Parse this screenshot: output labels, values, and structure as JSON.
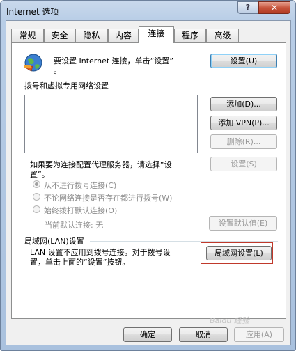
{
  "window": {
    "title": "Internet 选项",
    "help_label": "?",
    "close_label": "✕"
  },
  "tabs": [
    {
      "label": "常规"
    },
    {
      "label": "安全"
    },
    {
      "label": "隐私"
    },
    {
      "label": "内容"
    },
    {
      "label": "连接",
      "active": true
    },
    {
      "label": "程序"
    },
    {
      "label": "高级"
    }
  ],
  "setup": {
    "text_line1": "要设置 Internet 连接，单击“设置”",
    "text_line2": "。",
    "button": "设置(U)",
    "icon": "globe-network-icon"
  },
  "dialup": {
    "heading": "拨号和虚拟专用网络设置",
    "add_button": "添加(D)...",
    "add_vpn_button": "添加 VPN(P)...",
    "delete_button": "删除(R)...",
    "proxy_hint_line1": "如果要为连接配置代理服务器，请选择“设",
    "proxy_hint_line2": "置”。",
    "settings_button": "设置(S)",
    "options": [
      {
        "label": "从不进行拨号连接(C)",
        "checked": true
      },
      {
        "label": "不论网络连接是否存在都进行拨号(W)",
        "checked": false
      },
      {
        "label": "始终拨打默认连接(O)",
        "checked": false
      }
    ],
    "current_default": "当前默认连接:  无",
    "set_default_button": "设置默认值(E)"
  },
  "lan": {
    "heading": "局域网(LAN)设置",
    "text_line1": "LAN 设置不应用到拨号连接。对于拨号设",
    "text_line2": "置，单击上面的“设置”按钮。",
    "button": "局域网设置(L)"
  },
  "footer": {
    "ok": "确定",
    "cancel": "取消",
    "apply": "应用(A)"
  },
  "watermark": "Baidu 经验"
}
